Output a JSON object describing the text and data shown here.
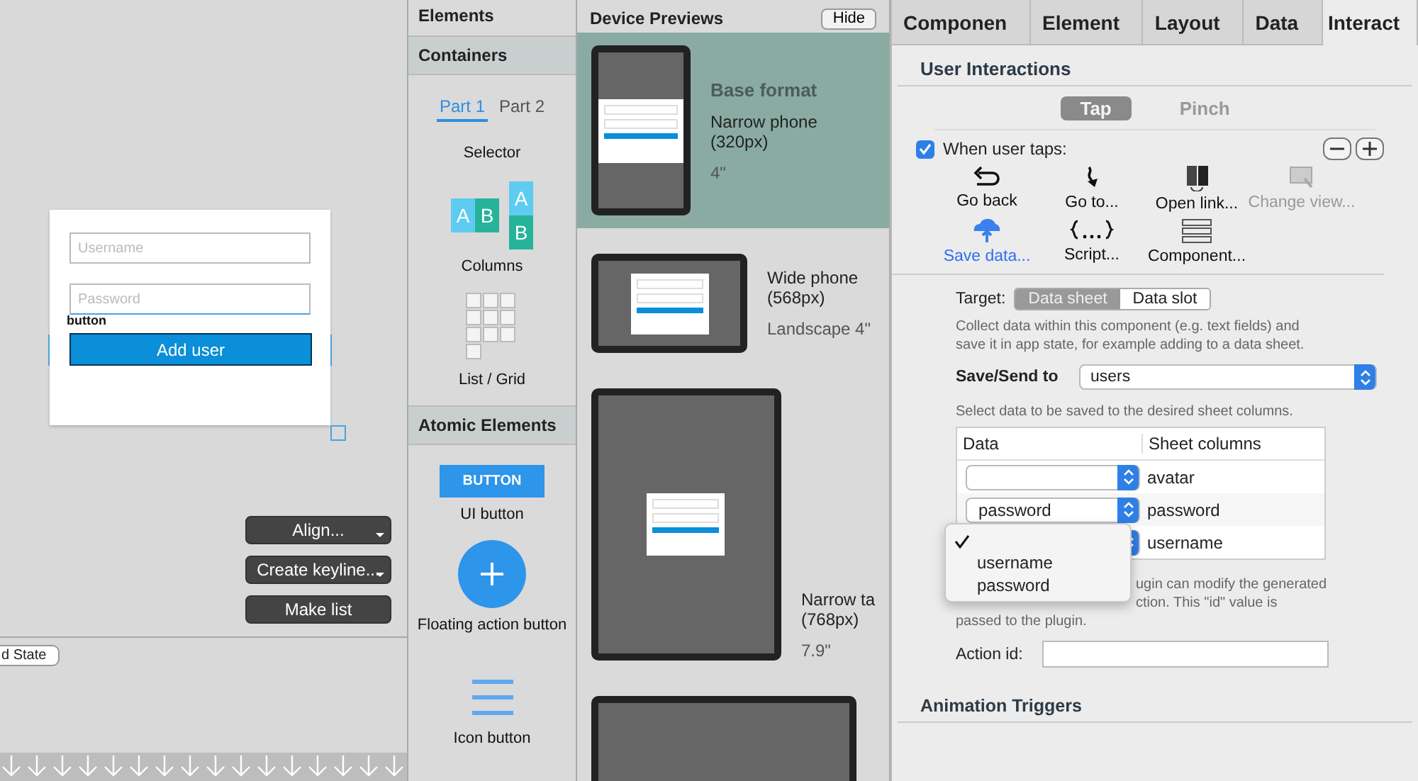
{
  "canvas": {
    "form": {
      "fields": [
        {
          "placeholder": "Username"
        },
        {
          "placeholder": "Password"
        }
      ],
      "selection_label": "button",
      "button": "Add user"
    },
    "actions": [
      {
        "label": "Align...",
        "has_menu": true
      },
      {
        "label": "Create keyline...",
        "has_menu": true
      },
      {
        "label": "Make list",
        "has_menu": false
      }
    ],
    "state_tab": "d State"
  },
  "elements_panel": {
    "title": "Elements",
    "sections": [
      {
        "title": "Containers",
        "tabs": [
          {
            "label": "Part 1",
            "selected": true
          },
          {
            "label": "Part 2",
            "selected": false
          }
        ],
        "items": [
          {
            "kind": "selector",
            "label": "Selector"
          },
          {
            "kind": "columns",
            "label": "Columns",
            "letters": [
              "A",
              "B",
              "A",
              "B"
            ]
          },
          {
            "kind": "grid",
            "label": "List / Grid"
          }
        ]
      },
      {
        "title": "Atomic Elements",
        "items": [
          {
            "kind": "ui_button",
            "caption": "BUTTON",
            "label": "UI button"
          },
          {
            "kind": "fab",
            "label": "Floating action button"
          },
          {
            "kind": "icon_button",
            "label": "Icon button"
          }
        ]
      }
    ]
  },
  "device_previews": {
    "title": "Device Previews",
    "hide_button": "Hide",
    "devices": [
      {
        "kind": "portrait",
        "selected": true,
        "heading": "Base format",
        "name": [
          "Narrow phone",
          "(320px)"
        ],
        "size": "4\""
      },
      {
        "kind": "landscape",
        "selected": false,
        "name": [
          "Wide phone",
          "(568px)"
        ],
        "size": "Landscape 4\""
      },
      {
        "kind": "tablet",
        "selected": false,
        "name": [
          "Narrow ta",
          "(768px)"
        ],
        "size": "7.9\""
      },
      {
        "kind": "partial",
        "selected": false
      }
    ]
  },
  "inspector": {
    "tabs": [
      {
        "label": "Componen",
        "selected": false
      },
      {
        "label": "Element",
        "selected": false
      },
      {
        "label": "Layout",
        "selected": false
      },
      {
        "label": "Data",
        "selected": false
      },
      {
        "label": "Interact",
        "selected": true
      }
    ],
    "section": "User Interactions",
    "gestures": [
      {
        "label": "Tap",
        "selected": true
      },
      {
        "label": "Pinch",
        "selected": false
      }
    ],
    "when_taps": {
      "label": "When user taps:",
      "checked": true
    },
    "actions": [
      {
        "kind": "back",
        "label": "Go back",
        "selected": false,
        "disabled": false
      },
      {
        "kind": "goto",
        "label": "Go to...",
        "selected": false,
        "disabled": false
      },
      {
        "kind": "link",
        "label": "Open link...",
        "selected": false,
        "disabled": false
      },
      {
        "kind": "view",
        "label": "Change view...",
        "selected": false,
        "disabled": true
      },
      {
        "kind": "save",
        "label": "Save data...",
        "selected": true,
        "disabled": false
      },
      {
        "kind": "script",
        "label": "Script...",
        "selected": false,
        "disabled": false
      },
      {
        "kind": "component",
        "label": "Component...",
        "selected": false,
        "disabled": false
      }
    ],
    "target": {
      "label": "Target:",
      "options": [
        {
          "label": "Data sheet",
          "selected": true
        },
        {
          "label": "Data slot",
          "selected": false
        }
      ]
    },
    "description": "Collect data within this component (e.g. text fields) and save it in app state, for example adding to a data sheet.",
    "save_to": {
      "label": "Save/Send to",
      "value": "users"
    },
    "hint": "Select data to be saved to the desired sheet columns.",
    "table": {
      "columns": [
        "Data",
        "Sheet columns"
      ],
      "rows": [
        {
          "column": "avatar"
        },
        {
          "data": "password",
          "column": "password"
        },
        {
          "column": "username"
        }
      ]
    },
    "menu": [
      {
        "checked": true
      },
      {
        "label": "username",
        "checked": false
      },
      {
        "label": "password",
        "checked": false
      }
    ],
    "note_lines": [
      "ugin can modify the generated",
      "ction. This \"id\" value is",
      "passed to the plugin."
    ],
    "action_id": {
      "label": "Action id:"
    },
    "next_section": "Animation Triggers"
  }
}
